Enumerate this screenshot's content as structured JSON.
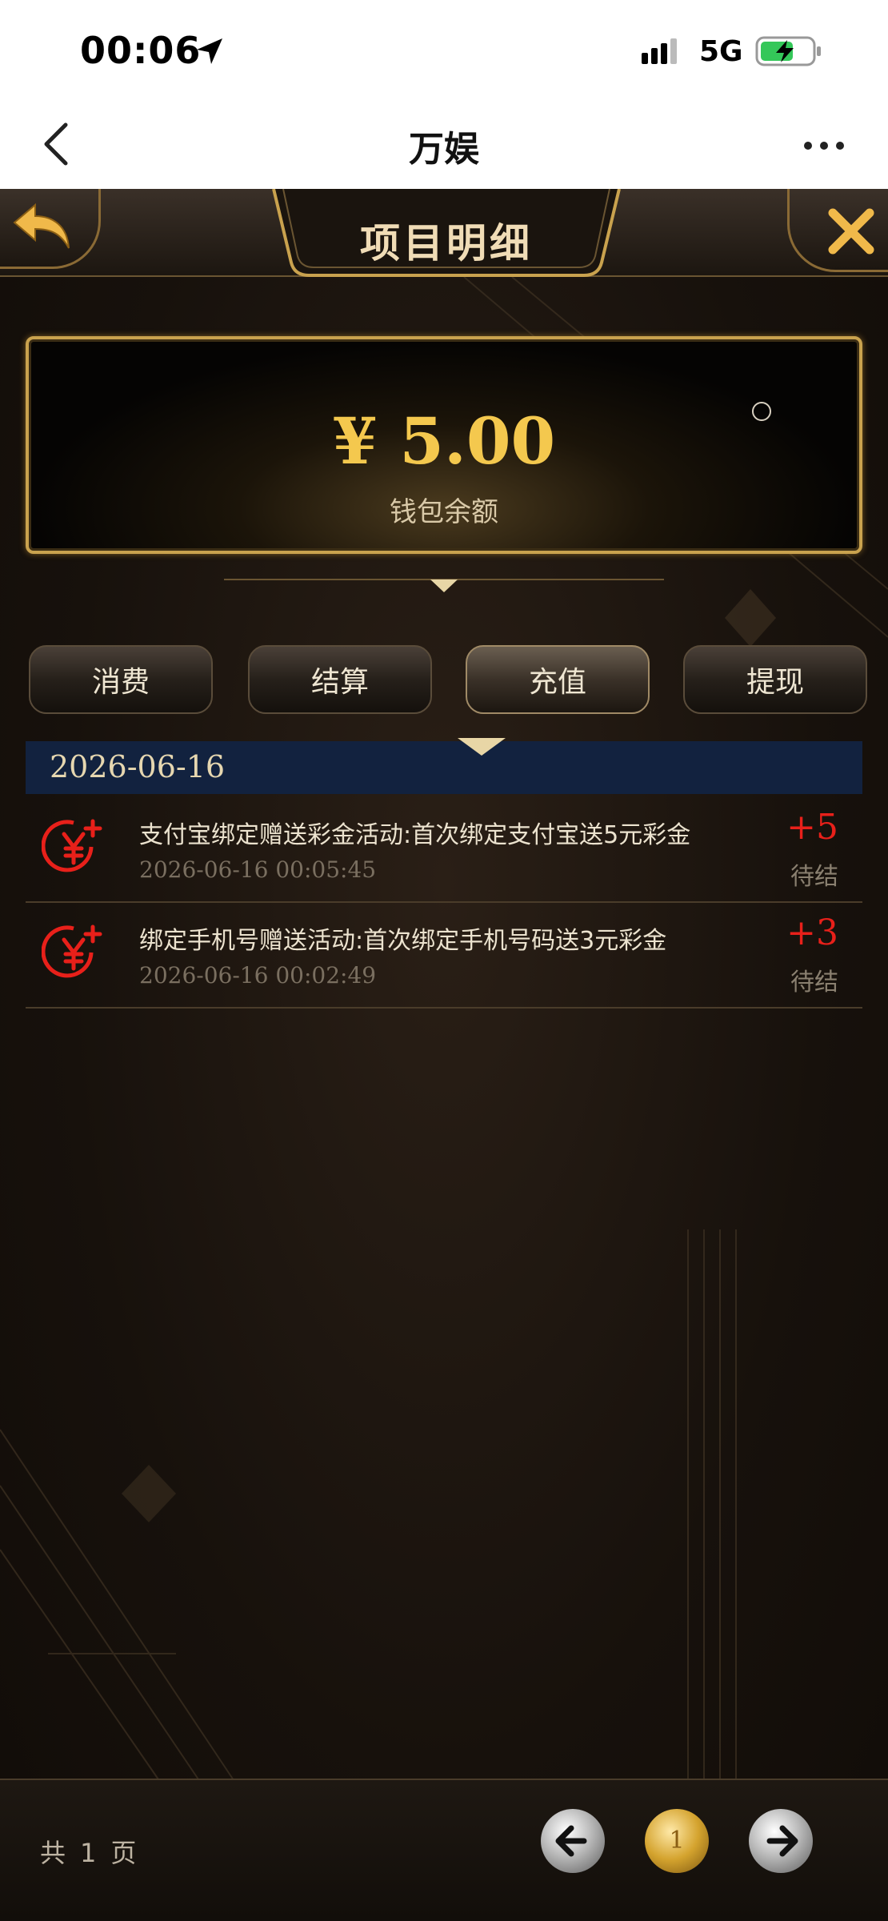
{
  "status_bar": {
    "time": "00:06",
    "network": "5G"
  },
  "nav": {
    "title": "万娱"
  },
  "header": {
    "title": "项目明细"
  },
  "balance": {
    "amount": "¥ 5.00",
    "label": "钱包余额"
  },
  "tabs": [
    {
      "label": "消费"
    },
    {
      "label": "结算"
    },
    {
      "label": "充值",
      "active": true
    },
    {
      "label": "提现"
    }
  ],
  "date_group": "2026-06-16",
  "records": [
    {
      "title": "支付宝绑定赠送彩金活动:首次绑定支付宝送5元彩金",
      "time": "2026-06-16 00:05:45",
      "amount": "+5",
      "status": "待结"
    },
    {
      "title": "绑定手机号赠送活动:首次绑定手机号码送3元彩金",
      "time": "2026-06-16 00:02:49",
      "amount": "+3",
      "status": "待结"
    }
  ],
  "pagination": {
    "total_prefix": "共",
    "total_pages": "1",
    "total_suffix": "页",
    "current_page": "1"
  },
  "colors": {
    "gold": "#c9a24e",
    "amount_red": "#e8201a",
    "date_bar": "#12223f"
  }
}
